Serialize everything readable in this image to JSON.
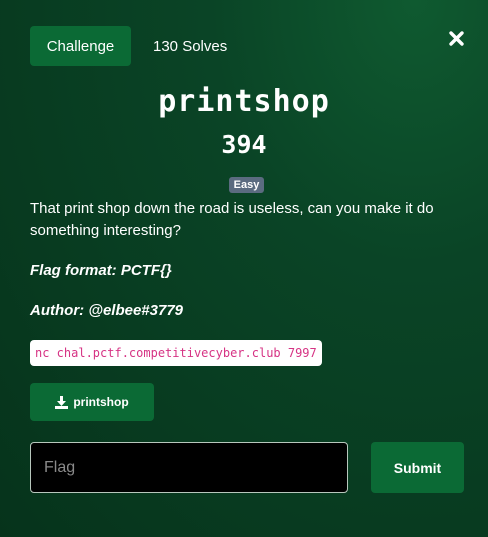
{
  "header": {
    "tab_label": "Challenge",
    "solves_text": "130 Solves",
    "close_icon": "close-icon"
  },
  "challenge": {
    "name": "printshop",
    "points": "394",
    "difficulty": "Easy",
    "difficulty_color": "#5b6b80",
    "description": "That print shop down the road is useless, can you make it do something interesting?",
    "flag_format": "Flag format: PCTF{}",
    "author": "Author: @elbee#3779",
    "connection": "nc chal.pctf.competitivecyber.club 7997",
    "file": {
      "icon": "download-icon",
      "label": "printshop"
    }
  },
  "form": {
    "flag_placeholder": "Flag",
    "flag_value": "",
    "submit_label": "Submit"
  },
  "colors": {
    "accent": "#0b6a35",
    "background": "#0a4426",
    "code_text": "#d63384"
  }
}
